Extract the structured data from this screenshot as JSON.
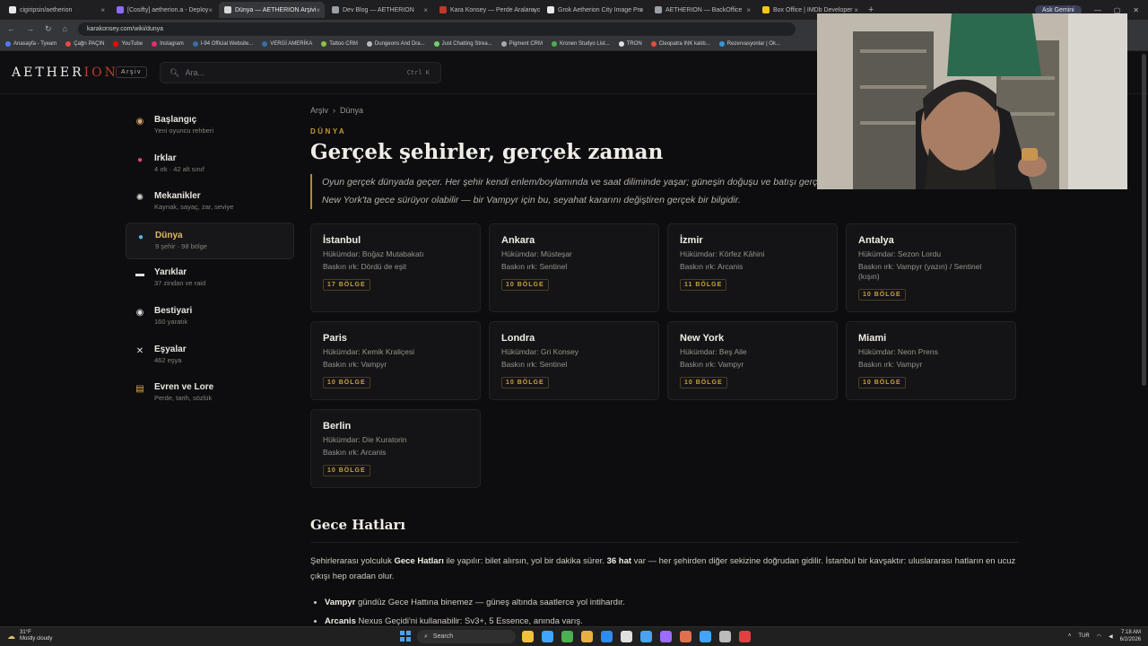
{
  "browser": {
    "tabs": [
      {
        "title": "cigiripsin/aetherion",
        "color": "#e8e8e8",
        "active": false
      },
      {
        "title": "[Cosifty] aetherion.a - Deploy",
        "color": "#8a6cff",
        "active": false
      },
      {
        "title": "Dünya — AETHERION Arşivi",
        "color": "#d8d8d8",
        "active": true
      },
      {
        "title": "Dev Blog — AETHERION",
        "color": "#9aa0a6",
        "active": false
      },
      {
        "title": "Kara Konsey — Perde Aralanıyo",
        "color": "#c0392b",
        "active": false
      },
      {
        "title": "Grok Aetherion City Image Pro",
        "color": "#e8e8e8",
        "active": false
      },
      {
        "title": "AETHERION — BackOffice",
        "color": "#9aa0a6",
        "active": false
      },
      {
        "title": "Box Office | IMDb Developer",
        "color": "#f5c518",
        "active": false
      }
    ],
    "new_tab": "+",
    "profile": "Ask Gemini",
    "url": "karakonsey.com/wiki/dunya",
    "bookmarks": [
      {
        "label": "Anasayfa - Tyeam",
        "color": "#4a7dff"
      },
      {
        "label": "Çağrı PAÇIN",
        "color": "#e74c3c"
      },
      {
        "label": "YouTube",
        "color": "#ff0000"
      },
      {
        "label": "Instagram",
        "color": "#e1306c"
      },
      {
        "label": "I-94 Official Website...",
        "color": "#3a6ea5"
      },
      {
        "label": "VERGİ AMERİKA",
        "color": "#3a6ea5"
      },
      {
        "label": "Tattoo CRM",
        "color": "#8bc34a"
      },
      {
        "label": "Dungeons And Dra...",
        "color": "#bbbbbb"
      },
      {
        "label": "Just Chatting Strea...",
        "color": "#6ad36a"
      },
      {
        "label": "Pigment CRM",
        "color": "#aaaaaa"
      },
      {
        "label": "Kronen Studyo List...",
        "color": "#4caf50"
      },
      {
        "label": "TRON",
        "color": "#e0e0e0"
      },
      {
        "label": "Cleopatra INK kalıb...",
        "color": "#e74c3c"
      },
      {
        "label": "Rezervasyonlar | Ok...",
        "color": "#3498db"
      }
    ]
  },
  "header": {
    "logo_main": "AETHER",
    "logo_accent": "ION",
    "archive_label": "Arşiv",
    "search_placeholder": "Ara...",
    "search_shortcut": "Ctrl K"
  },
  "sidebar": {
    "items": [
      {
        "title": "Başlangıç",
        "sub": "Yeni oyuncu rehberi",
        "icon": "compass-icon",
        "glyph": "◉",
        "color": "#d7a86e",
        "active": false
      },
      {
        "title": "Irklar",
        "sub": "4 ırk · 42 alt sınıf",
        "icon": "blood-drop-icon",
        "glyph": "●",
        "color": "#e0457b",
        "active": false
      },
      {
        "title": "Mekanikler",
        "sub": "Kaynak, sayaç, zar, seviye",
        "icon": "gear-icon",
        "glyph": "✺",
        "color": "#d8d4cc",
        "active": false
      },
      {
        "title": "Dünya",
        "sub": "9 şehir · 98 bölge",
        "icon": "globe-icon",
        "glyph": "●",
        "color": "#5ab4e6",
        "active": true
      },
      {
        "title": "Yarıklar",
        "sub": "37 zindan ve raid",
        "icon": "rift-icon",
        "glyph": "▬",
        "color": "#e0e0e0",
        "active": false
      },
      {
        "title": "Bestiyari",
        "sub": "160 yaratık",
        "icon": "eye-icon",
        "glyph": "◉",
        "color": "#e0e0e0",
        "active": false
      },
      {
        "title": "Eşyalar",
        "sub": "462 eşya",
        "icon": "crossed-swords-icon",
        "glyph": "✕",
        "color": "#e0e0e0",
        "active": false
      },
      {
        "title": "Evren ve Lore",
        "sub": "Perde, tarih, sözlük",
        "icon": "book-icon",
        "glyph": "▤",
        "color": "#e0a84a",
        "active": false
      }
    ]
  },
  "main": {
    "breadcrumb": [
      "Arşiv",
      "Dünya"
    ],
    "breadcrumb_sep": "›",
    "eyebrow": "DÜNYA",
    "title": "Gerçek şehirler, gerçek zaman",
    "lead": "Oyun gerçek dünyada geçer. Her şehir kendi enlem/boylamında ve saat diliminde yaşar; güneşin doğuşu ve batışı gerçek zamanlı. İstanbul'da sabah olurken New York'ta gece sürüyor olabilir — bir Vampyr için bu, seyahat kararını değiştiren gerçek bir bilgidir.",
    "cities": [
      {
        "name": "İstanbul",
        "ruler": "Hükümdar: Boğaz Mutabakatı",
        "race": "Baskın ırk: Dördü de eşit",
        "regions": "17 BÖLGE"
      },
      {
        "name": "Ankara",
        "ruler": "Hükümdar: Müsteşar",
        "race": "Baskın ırk: Sentinel",
        "regions": "10 BÖLGE"
      },
      {
        "name": "İzmir",
        "ruler": "Hükümdar: Körfez Kâhini",
        "race": "Baskın ırk: Arcanis",
        "regions": "11 BÖLGE"
      },
      {
        "name": "Antalya",
        "ruler": "Hükümdar: Sezon Lordu",
        "race": "Baskın ırk: Vampyr (yazın) / Sentinel (kışın)",
        "regions": "10 BÖLGE"
      },
      {
        "name": "Paris",
        "ruler": "Hükümdar: Kemik Kraliçesi",
        "race": "Baskın ırk: Vampyr",
        "regions": "10 BÖLGE"
      },
      {
        "name": "Londra",
        "ruler": "Hükümdar: Gri Konsey",
        "race": "Baskın ırk: Sentinel",
        "regions": "10 BÖLGE"
      },
      {
        "name": "New York",
        "ruler": "Hükümdar: Beş Aile",
        "race": "Baskın ırk: Vampyr",
        "regions": "10 BÖLGE"
      },
      {
        "name": "Miami",
        "ruler": "Hükümdar: Neon Prens",
        "race": "Baskın ırk: Vampyr",
        "regions": "10 BÖLGE"
      },
      {
        "name": "Berlin",
        "ruler": "Hükümdar: Die Kuratorin",
        "race": "Baskın ırk: Arcanis",
        "regions": "10 BÖLGE"
      }
    ],
    "section_title": "Gece Hatları",
    "para_1": "Şehirlerarası yolculuk ",
    "para_bold_1": "Gece Hatları",
    "para_2": " ile yapılır: bilet alırsın, yol bir dakika sürer. ",
    "para_bold_2": "36 hat",
    "para_3": " var — her şehirden diğer sekizine doğrudan gidilir. İstanbul bir kavşaktır: uluslararası hatların en ucuz çıkışı hep oradan olur.",
    "bullets": [
      {
        "bold": "Vampyr",
        "text": " gündüz Gece Hattına binemez — güneş altında saatlerce yol intihardır."
      },
      {
        "bold": "Arcanis",
        "text": " Nexus Geçidi'ni kullanabilir: Sv3+, 5 Essence, anında varış."
      }
    ]
  },
  "taskbar": {
    "weather_temp": "31°F",
    "weather_desc": "Mostly cloudy",
    "search_label": "Search",
    "lang": "TUR",
    "time": "7:18 AM",
    "date": "6/2/2026",
    "app_colors": [
      "#f0c040",
      "#3ea6ff",
      "#4caf50",
      "#e8b040",
      "#2d8cf0",
      "#e0e0e0",
      "#4aa3f0",
      "#9c6cff",
      "#e07050",
      "#3ea6ff",
      "#bbbbbb",
      "#e04040"
    ]
  }
}
